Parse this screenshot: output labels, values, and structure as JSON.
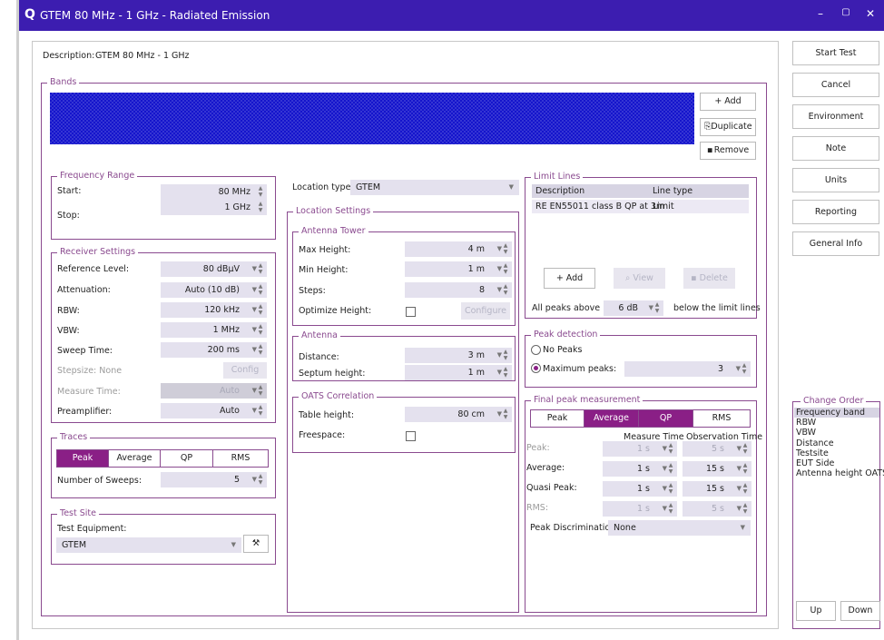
{
  "window": {
    "title": "GTEM 80 MHz - 1 GHz - Radiated Emission",
    "logo": "Q",
    "minimize": "–",
    "maximize": "▢",
    "close": "✕"
  },
  "description": {
    "label": "Description:",
    "value": "GTEM 80 MHz - 1 GHz"
  },
  "bands": {
    "legend": "Bands",
    "add": "+ Add",
    "duplicate": "Duplicate",
    "remove": "Remove"
  },
  "frequency_range": {
    "legend": "Frequency Range",
    "start_label": "Start:",
    "start_value": "80 MHz",
    "stop_label": "Stop:",
    "stop_value": "1 GHz"
  },
  "receiver": {
    "legend": "Receiver Settings",
    "reference_level_label": "Reference Level:",
    "reference_level_value": "80 dBµV",
    "attenuation_label": "Attenuation:",
    "attenuation_value": "Auto (10 dB)",
    "rbw_label": "RBW:",
    "rbw_value": "120 kHz",
    "vbw_label": "VBW:",
    "vbw_value": "1 MHz",
    "sweep_time_label": "Sweep Time:",
    "sweep_time_value": "200 ms",
    "stepsize_label": "Stepsize: None",
    "config": "Config",
    "measure_time_label": "Measure Time:",
    "measure_time_value": "Auto",
    "preamplifier_label": "Preamplifier:",
    "preamplifier_value": "Auto"
  },
  "traces": {
    "legend": "Traces",
    "peak": "Peak",
    "average": "Average",
    "qp": "QP",
    "rms": "RMS",
    "sweeps_label": "Number of Sweeps:",
    "sweeps_value": "5"
  },
  "test_site": {
    "legend": "Test Site",
    "equipment_label": "Test Equipment:",
    "equipment_value": "GTEM"
  },
  "location": {
    "type_label": "Location type:",
    "type_value": "GTEM",
    "settings_legend": "Location Settings"
  },
  "antenna_tower": {
    "legend": "Antenna Tower",
    "max_label": "Max Height:",
    "max_value": "4 m",
    "min_label": "Min Height:",
    "min_value": "1 m",
    "steps_label": "Steps:",
    "steps_value": "8",
    "optimize_label": "Optimize Height:",
    "configure": "Configure"
  },
  "antenna": {
    "legend": "Antenna",
    "distance_label": "Distance:",
    "distance_value": "3 m",
    "septum_label": "Septum height:",
    "septum_value": "1 m"
  },
  "oats": {
    "legend": "OATS Correlation",
    "table_label": "Table height:",
    "table_value": "80 cm",
    "freespace_label": "Freespace:"
  },
  "limit_lines": {
    "legend": "Limit Lines",
    "col_description": "Description",
    "col_type": "Line type",
    "rows": [
      {
        "description": "RE EN55011 class B QP at 3m",
        "type": "Limit"
      }
    ],
    "add": "+ Add",
    "view": "View",
    "delete": "Delete",
    "peaks_above_label": "All peaks above",
    "peaks_above_value": "6 dB",
    "below_label": "below the limit lines"
  },
  "peak_detection": {
    "legend": "Peak detection",
    "no_peaks": "No Peaks",
    "maximum_peaks": "Maximum peaks:",
    "maximum_value": "3"
  },
  "final_peak": {
    "legend": "Final peak measurement",
    "peak": "Peak",
    "average": "Average",
    "qp": "QP",
    "rms": "RMS",
    "measure_time": "Measure Time",
    "observation_time": "Observation Time",
    "rows": [
      {
        "label": "Peak:",
        "measure": "1 s",
        "observation": "5 s"
      },
      {
        "label": "Average:",
        "measure": "1 s",
        "observation": "15 s"
      },
      {
        "label": "Quasi Peak:",
        "measure": "1 s",
        "observation": "15 s"
      },
      {
        "label": "RMS:",
        "measure": "1 s",
        "observation": "5 s"
      }
    ],
    "discrimination_label": "Peak Discrimination:",
    "discrimination_value": "None"
  },
  "right_buttons": {
    "start_test": "Start Test",
    "cancel": "Cancel",
    "environment": "Environment",
    "note": "Note",
    "units": "Units",
    "reporting": "Reporting",
    "general_info": "General Info"
  },
  "change_order": {
    "legend": "Change Order",
    "items": [
      "Frequency band",
      "RBW",
      "VBW",
      "Distance",
      "Testsite",
      "EUT Side",
      "Antenna height OATS"
    ],
    "up": "Up",
    "down": "Down"
  },
  "colors": {
    "titlebar": "#3c1db0",
    "accent": "#8a1f86",
    "bands": "#1414cc"
  }
}
